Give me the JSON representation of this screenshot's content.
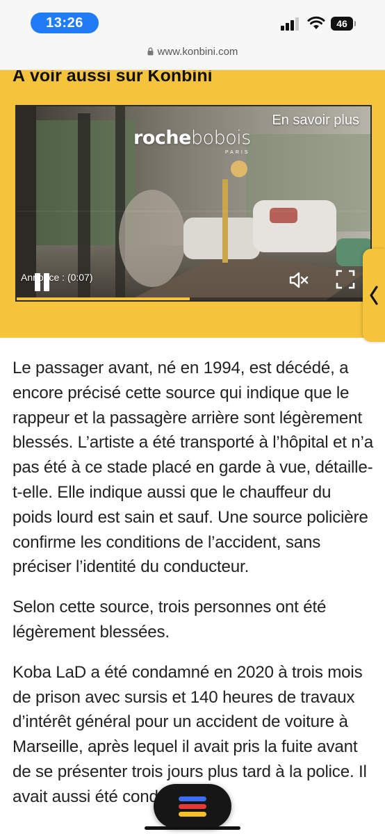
{
  "status_bar": {
    "time": "13:26",
    "battery": "46",
    "icons": [
      "signal-icon",
      "wifi-icon",
      "battery-icon"
    ]
  },
  "browser": {
    "url": "www.konbini.com",
    "lock_icon": "lock-icon"
  },
  "promo": {
    "heading": "À voir aussi sur Konbini",
    "background_color": "#f5c43c",
    "video": {
      "brand_bold": "roche",
      "brand_light": "bobois",
      "brand_sub": "PARIS",
      "learn_more": "En savoir plus",
      "ad_label": "Annonce : (0:07)",
      "progress": 0.49,
      "controls": [
        "pause-icon",
        "mute-icon",
        "fullscreen-icon"
      ]
    },
    "side_tab_icon": "chevron-left-icon"
  },
  "article": {
    "paragraphs": [
      "Le passager avant, né en 1994, est décédé, a encore précisé cette source qui indique que le rappeur et la passagère arrière sont légèrement blessés. L’artiste a été transporté à l’hôpital et n’a pas été à ce stade placé en garde à vue, détaille-t-elle. Elle indique aussi que le chauffeur du poids lourd est sain et sauf. Une source policière confirme les conditions de l’accident, sans préciser l’identité du conducteur.",
      "Selon cette source, trois personnes ont été légèrement blessées.",
      "Koba LaD a été condamné en 2020 à trois mois de prison avec sursis et 140 heures de travaux d’intérêt général pour un accident de voiture à Marseille, après lequel il avait pris la fuite avant de se présenter trois jours plus tard à la police. Il avait aussi été condamné à"
    ]
  },
  "floating_button": {
    "icon": "google-news-menu-icon",
    "colors": [
      "#3b6ef5",
      "#e53935",
      "#f6c026"
    ]
  }
}
